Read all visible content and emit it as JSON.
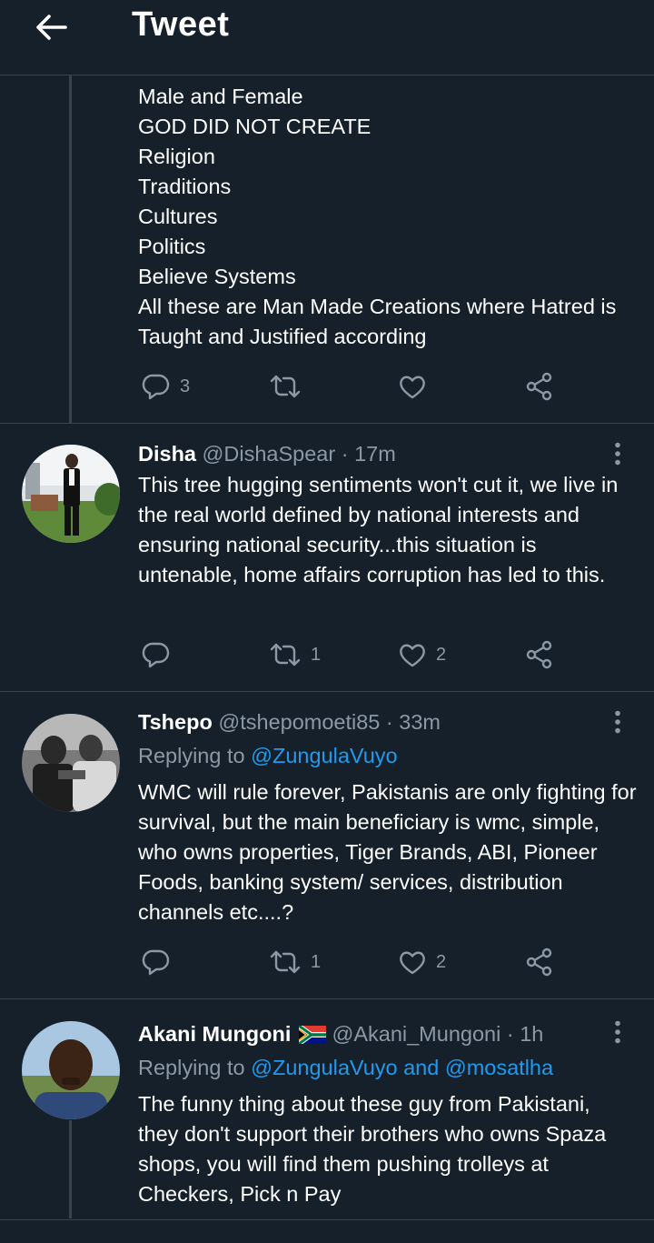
{
  "header": {
    "title": "Tweet"
  },
  "tweets": [
    {
      "body": "Male and Female\nGOD DID NOT CREATE\nReligion\nTraditions\nCultures\nPolitics\nBelieve Systems\nAll these are Man Made Creations where Hatred is Taught and Justified according",
      "replies": "3",
      "retweets": "",
      "likes": ""
    },
    {
      "name": "Disha",
      "handle": "@DishaSpear",
      "time": "· 17m",
      "body": "This tree hugging sentiments won't cut it, we live in the real world defined by national interests and ensuring national security...this situation is untenable, home affairs corruption has led to this.",
      "replies": "",
      "retweets": "1",
      "likes": "2"
    },
    {
      "name": "Tshepo",
      "handle": "@tshepomoeti85",
      "time": "· 33m",
      "replying_prefix": "Replying to ",
      "replying_to": "@ZungulaVuyo",
      "body": "WMC will rule forever, Pakistanis are only fighting for survival, but the main beneficiary is wmc, simple, who owns properties, Tiger Brands, ABI, Pioneer Foods, banking system/ services, distribution channels etc....?",
      "replies": "",
      "retweets": "1",
      "likes": "2"
    },
    {
      "name": "Akani Mungoni",
      "handle": "@Akani_Mungoni",
      "time": "· 1h",
      "replying_prefix": "Replying to ",
      "replying_to": "@ZungulaVuyo and @mosatlha",
      "body": "The funny thing about these guy from Pakistani, they don't support their brothers who owns Spaza shops, you will find them pushing trolleys at Checkers, Pick n Pay"
    }
  ],
  "icons": {
    "back": "arrow-left-icon",
    "reply": "reply-icon",
    "retweet": "retweet-icon",
    "like": "heart-icon",
    "share": "share-icon",
    "more": "more-vertical-icon",
    "flag": "south-africa-flag-icon"
  },
  "colors": {
    "background": "#15202b",
    "text": "#ffffff",
    "muted": "#8b98a5",
    "link": "#1d9bf0",
    "divider": "#38444d"
  }
}
